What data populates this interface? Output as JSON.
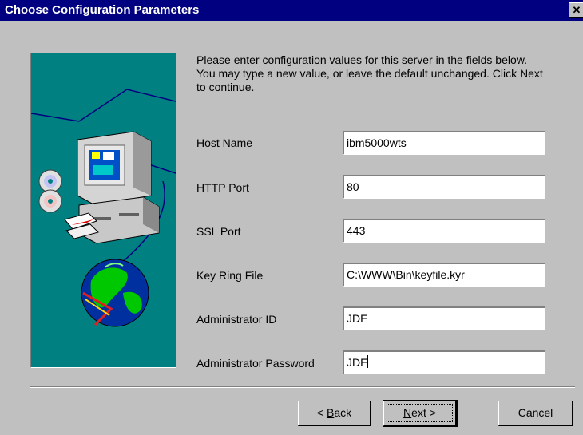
{
  "window": {
    "title": "Choose Configuration Parameters",
    "close_glyph": "✕"
  },
  "intro_text": "Please enter configuration values for this server in the fields below. You may type a new value, or leave the default unchanged. Click Next to continue.",
  "fields": {
    "host_name": {
      "label": "Host Name",
      "value": "ibm5000wts"
    },
    "http_port": {
      "label": "HTTP Port",
      "value": "80"
    },
    "ssl_port": {
      "label": "SSL Port",
      "value": "443"
    },
    "key_ring_file": {
      "label": "Key Ring File",
      "value": "C:\\WWW\\Bin\\keyfile.kyr"
    },
    "admin_id": {
      "label": "Administrator ID",
      "value": "JDE"
    },
    "admin_password": {
      "label": "Administrator Password",
      "value": "JDE"
    }
  },
  "buttons": {
    "back": {
      "mnemonic": "B",
      "rest": "ack",
      "prefix": "< ",
      "suffix": ""
    },
    "next": {
      "mnemonic": "N",
      "rest": "ext",
      "prefix": "",
      "suffix": " >"
    },
    "cancel": {
      "label": "Cancel"
    }
  },
  "colors": {
    "titlebar": "#000080",
    "dialog": "#c0c0c0",
    "image_background": "#008080"
  },
  "icons": [
    "close-icon",
    "computer-icon",
    "cd-disc-icon",
    "floppy-disk-icon",
    "globe-icon"
  ]
}
